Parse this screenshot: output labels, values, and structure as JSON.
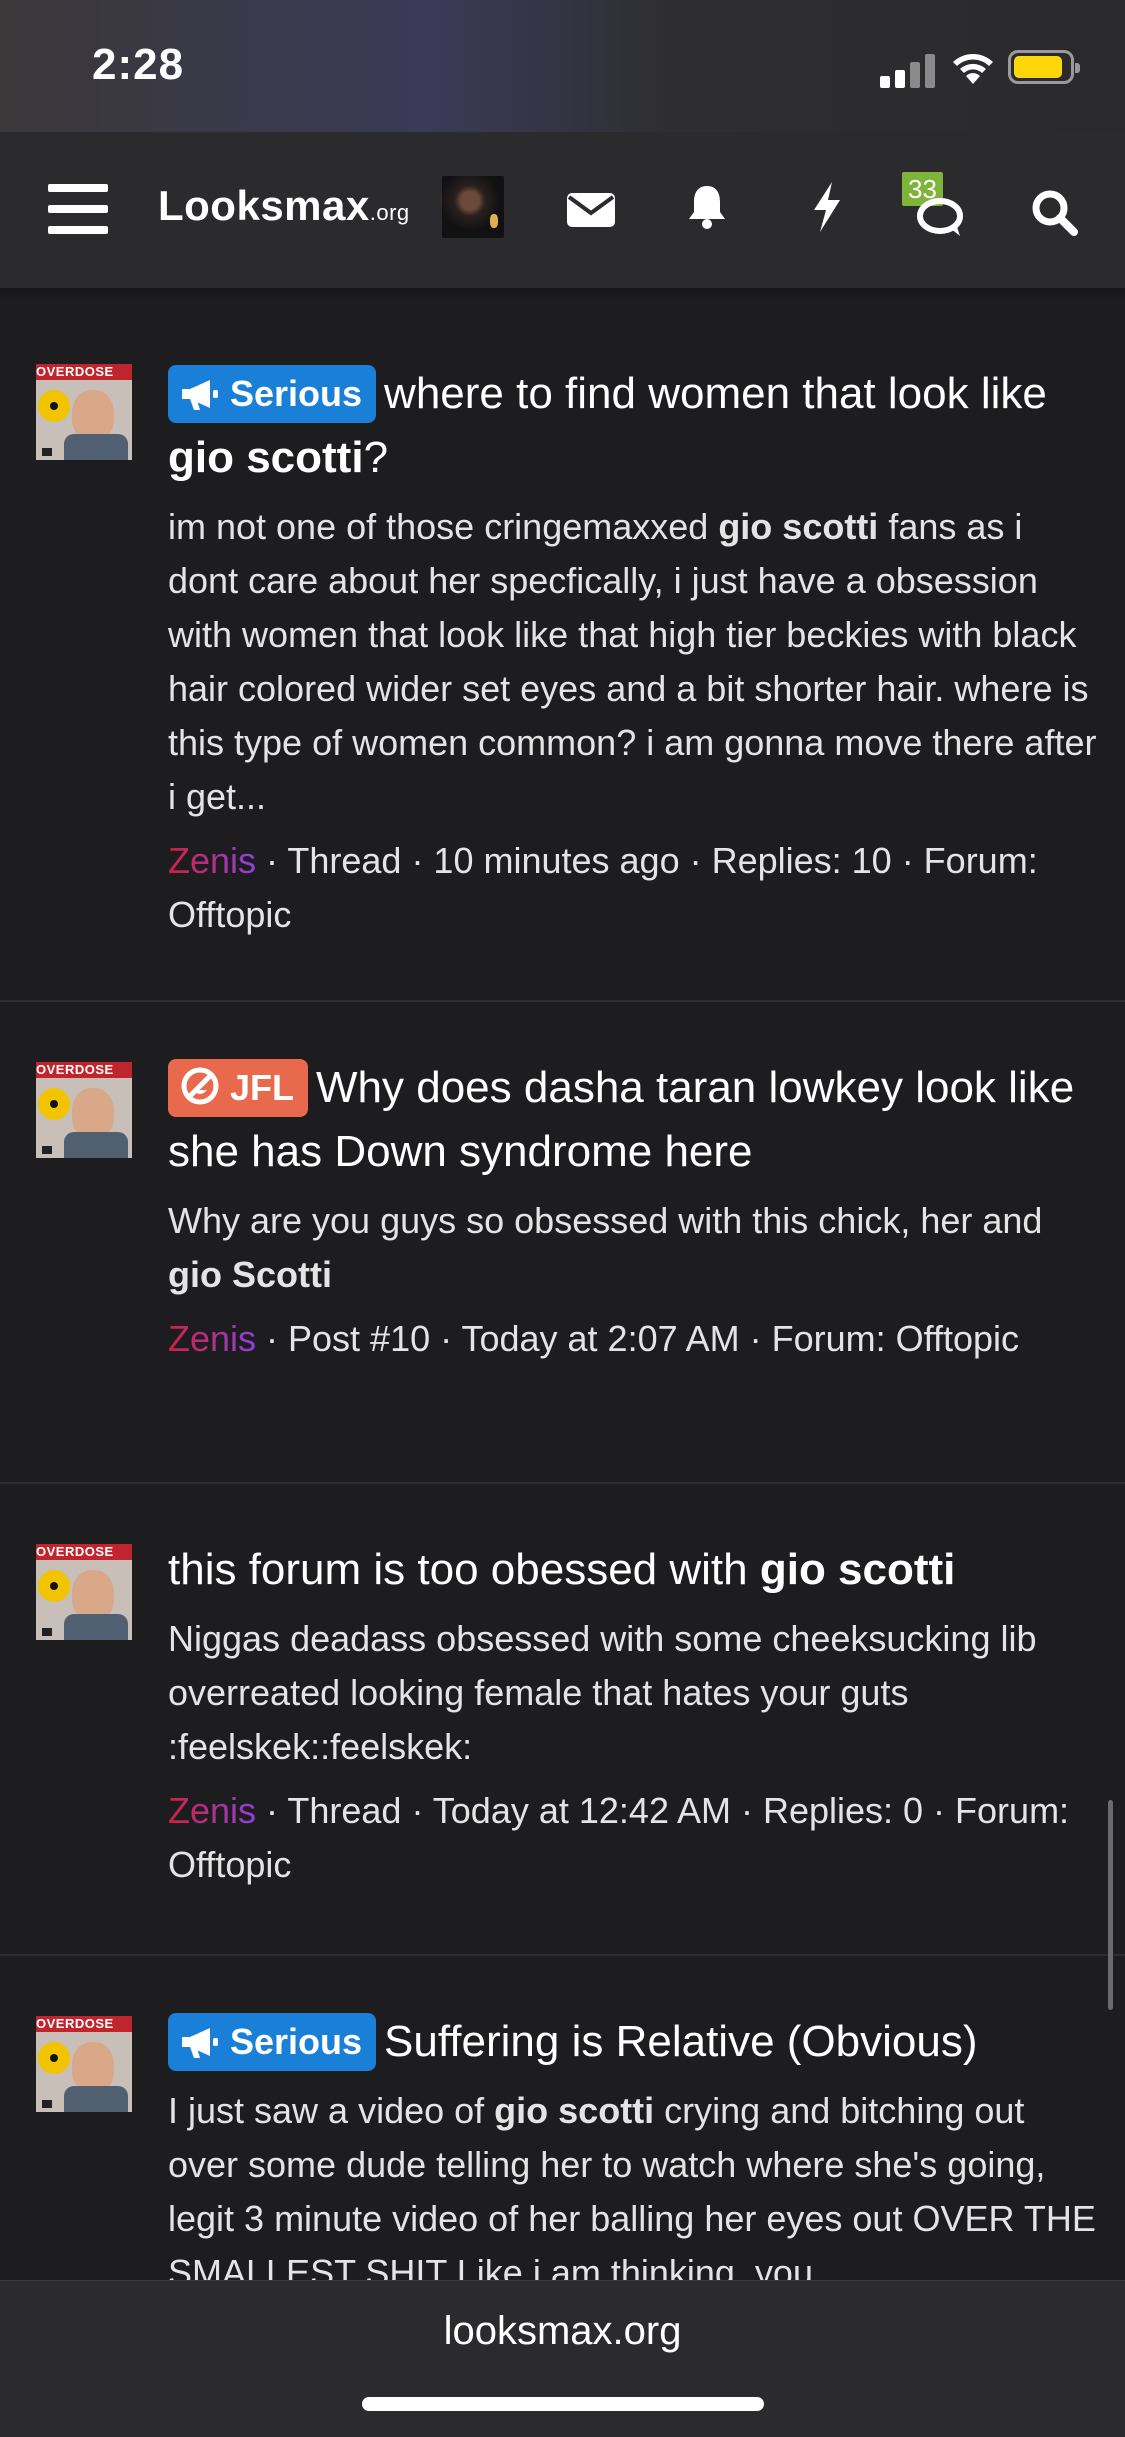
{
  "status_bar": {
    "time": "2:28"
  },
  "nav": {
    "logo_main": "Looksmax",
    "logo_suffix": ".org",
    "conversations_count": "33"
  },
  "results": [
    {
      "label": "Serious",
      "title_parts": [
        "where to find women that look like ",
        "gio scotti",
        "?"
      ],
      "snippet_parts": [
        "im not one of those cringemaxxed ",
        "gio scotti",
        " fans as i dont care about her specfically, i just have a obsession with women that look like that high tier beckies with black hair colored wider set eyes and a bit shorter hair. where is this type of women common? i am gonna move there after i get..."
      ],
      "user": "Zenis",
      "meta": " · Thread · 10 minutes ago · Replies: 10 · Forum: Offtopic",
      "avatar_banner": "OVERDOSE"
    },
    {
      "label": "JFL",
      "title_parts": [
        "Why does dasha taran lowkey look like she has Down syndrome here"
      ],
      "snippet_parts": [
        "Why are you guys so obsessed with this chick, her and ",
        "gio Scotti"
      ],
      "user": "Zenis",
      "meta": " · Post #10 · Today at 2:07 AM · Forum: Offtopic",
      "avatar_banner": "OVERDOSE"
    },
    {
      "label": "",
      "title_parts": [
        "this forum is too obessed with ",
        "gio scotti"
      ],
      "snippet_parts": [
        "Niggas deadass obsessed with some cheeksucking lib overreated looking female that hates your guts :feelskek::feelskek:"
      ],
      "user": "Zenis",
      "meta": " · Thread · Today at 12:42 AM · Replies: 0 · Forum: Offtopic",
      "avatar_banner": "OVERDOSE"
    },
    {
      "label": "Serious",
      "title_parts": [
        "Suffering is Relative (Obvious)"
      ],
      "snippet_parts": [
        "I just saw a video of ",
        "gio scotti",
        " crying and bitching out over some dude telling her to watch where she's going, legit 3 minute video of her balling her eyes out OVER THE SMALLEST SHIT Like i am thinking, you"
      ],
      "user": "",
      "meta": "",
      "avatar_banner": "OVERDOSE"
    }
  ],
  "bottom_bar": {
    "url": "looksmax.org"
  },
  "colors": {
    "serious": "#1a7fd6",
    "jfl": "#e8694b",
    "badge": "#7fb43a",
    "battery": "#ffd60a"
  }
}
